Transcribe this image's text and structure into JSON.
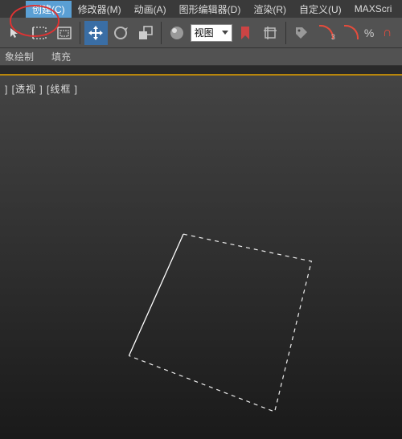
{
  "menu": {
    "spacer": "",
    "create": "创建(C)",
    "modify": "修改器(M)",
    "anim": "动画(A)",
    "graph": "图形编辑器(D)",
    "render": "渲染(R)",
    "custom": "自定义(U)",
    "script": "MAXScri"
  },
  "toolbar": {
    "view_dropdown": "视图",
    "percent": "%"
  },
  "row2": {
    "draw": "象绘制",
    "fill": "填充"
  },
  "viewport": {
    "label": "] [透视 ] [线框 ]"
  },
  "icons": {
    "arrow": "arrow-icon",
    "marquee": "marquee-icon",
    "window": "window-icon",
    "move": "move-icon",
    "rotate": "rotate-icon",
    "scale": "scale-icon",
    "sphere": "sphere-icon",
    "bookmark": "bookmark-icon",
    "crop": "crop-icon",
    "tag": "tag-icon",
    "magnet": "magnet-angle-icon",
    "magnet_end": "magnet-icon"
  }
}
